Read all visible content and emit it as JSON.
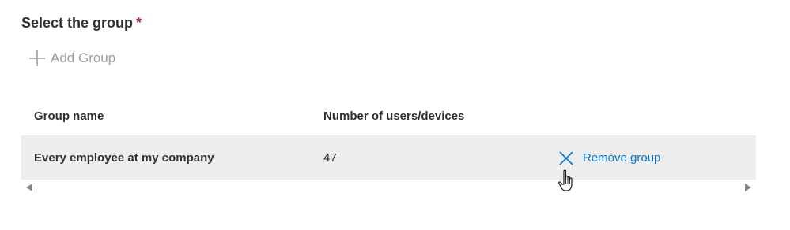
{
  "section": {
    "title": "Select the group",
    "required_marker": "*"
  },
  "add_group": {
    "label": "Add Group",
    "icon": "plus-icon"
  },
  "table": {
    "columns": [
      "Group name",
      "Number of users/devices"
    ],
    "rows": [
      {
        "group_name": "Every employee at my company",
        "count": "47",
        "action_label": "Remove group",
        "action_icon": "close-icon"
      }
    ]
  },
  "colors": {
    "accent": "#0078d4",
    "required": "#a4262c",
    "disabled_text": "#a19f9d",
    "row_background": "#ededed"
  }
}
